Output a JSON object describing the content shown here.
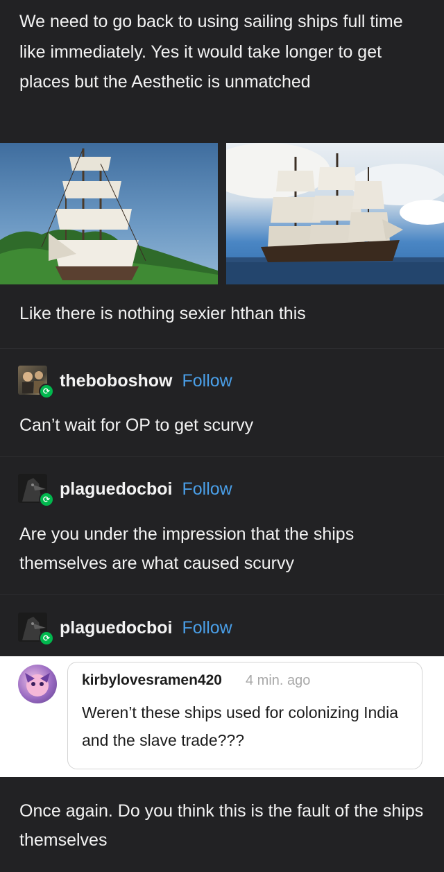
{
  "op": {
    "text": "We need to go back to using sailing ships full time like immediately. Yes it would take longer to get places but the Aesthetic is unmatched",
    "followup": "Like there is nothing sexier hthan this"
  },
  "reblogs": [
    {
      "username": "theboboshow",
      "follow_label": "Follow",
      "text": "Can’t wait for OP to get scurvy"
    },
    {
      "username": "plaguedocboi",
      "follow_label": "Follow",
      "text": "Are you under the impression that the ships themselves are what caused scurvy"
    },
    {
      "username": "plaguedocboi",
      "follow_label": "Follow",
      "text": "Once again. Do you think this is the fault of the ships themselves"
    }
  ],
  "reply": {
    "username": "kirbylovesramen420",
    "time": "4 min. ago",
    "text": "Weren’t these ships used for colonizing India and the slave trade???"
  },
  "colors": {
    "background": "#222224",
    "follow": "#4a9fe8",
    "reblog_badge": "#01b84e"
  },
  "icons": {
    "reblog": "reblog-icon"
  }
}
